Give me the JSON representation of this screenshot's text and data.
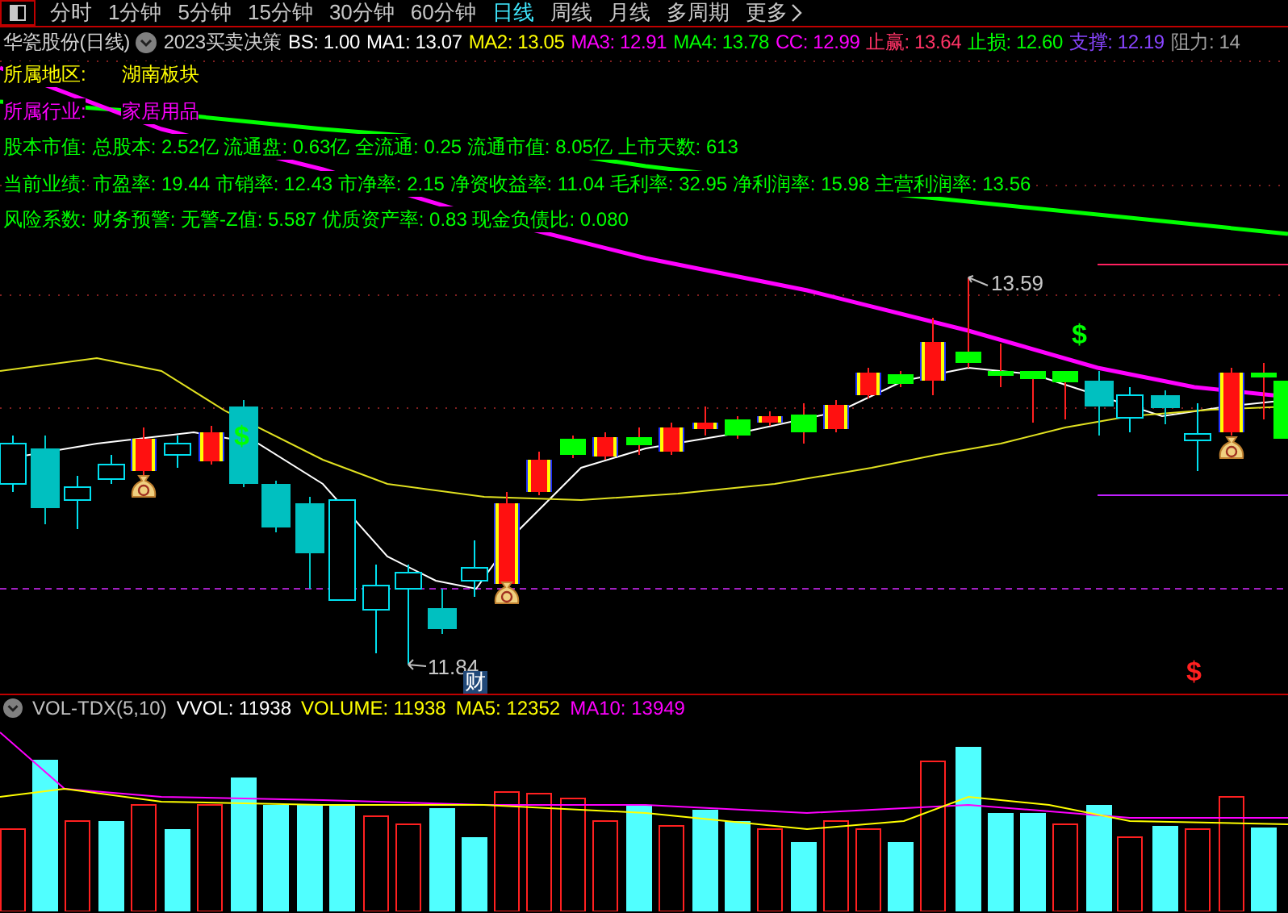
{
  "toolbar": {
    "tabs": [
      {
        "label": "分时",
        "selected": false
      },
      {
        "label": "1分钟",
        "selected": false
      },
      {
        "label": "5分钟",
        "selected": false
      },
      {
        "label": "15分钟",
        "selected": false
      },
      {
        "label": "30分钟",
        "selected": false
      },
      {
        "label": "60分钟",
        "selected": false
      },
      {
        "label": "日线",
        "selected": true
      },
      {
        "label": "周线",
        "selected": false
      },
      {
        "label": "月线",
        "selected": false
      },
      {
        "label": "多周期",
        "selected": false
      },
      {
        "label": "更多",
        "selected": false
      }
    ]
  },
  "indicator": {
    "title": "华瓷股份(日线)",
    "formula": "2023买卖决策",
    "values": [
      {
        "label": "BS: 1.00",
        "color": "#ffffff"
      },
      {
        "label": "MA1: 13.07",
        "color": "#ffffff"
      },
      {
        "label": "MA2: 13.05",
        "color": "#ffff00"
      },
      {
        "label": "MA3: 12.91",
        "color": "#ff00ff"
      },
      {
        "label": "MA4: 13.78",
        "color": "#00ff00"
      },
      {
        "label": "CC: 12.99",
        "color": "#ff00ff"
      },
      {
        "label": "止赢: 13.64",
        "color": "#ff3366"
      },
      {
        "label": "止损: 12.60",
        "color": "#00ff00"
      },
      {
        "label": "支撑: 12.19",
        "color": "#8844ff"
      },
      {
        "label": "阻力: 14",
        "color": "#a0a0a0"
      }
    ]
  },
  "info": [
    {
      "label": "所属地区:",
      "value": "湖南板块",
      "color": "#ffff00"
    },
    {
      "label": "所属行业:",
      "value": "家居用品",
      "color": "#ff00ff"
    },
    {
      "label": "股本市值:",
      "value": "总股本: 2.52亿 流通盘: 0.63亿 全流通: 0.25 流通市值: 8.05亿 上市天数: 613",
      "color": "#00ff00"
    },
    {
      "label": "当前业绩:",
      "value": "市盈率: 19.44 市销率: 12.43 市净率: 2.15 净资收益率: 11.04 毛利率: 32.95 净利润率: 15.98 主营利润率: 13.56",
      "color": "#00ff00"
    },
    {
      "label": "风险系数:",
      "value": "财务预警: 无警-Z值: 5.587 优质资产率: 0.83 现金负债比: 0.080",
      "color": "#00ff00"
    }
  ],
  "chart": {
    "high_label": "13.59",
    "low_label": "11.84",
    "badge": "财",
    "markers": [
      {
        "text": "$",
        "color": "#00ff00"
      },
      {
        "text": "$",
        "color": "#00ff00"
      },
      {
        "text": "$",
        "color": "#ff2020"
      }
    ]
  },
  "volume": {
    "name": "VOL-TDX(5,10)",
    "values": [
      {
        "label": "VVOL: 11938",
        "color": "#ffffff"
      },
      {
        "label": "VOLUME: 11938",
        "color": "#ffff00"
      },
      {
        "label": "MA5: 12352",
        "color": "#ffff00"
      },
      {
        "label": "MA10: 13949",
        "color": "#ff00ff"
      }
    ]
  }
}
